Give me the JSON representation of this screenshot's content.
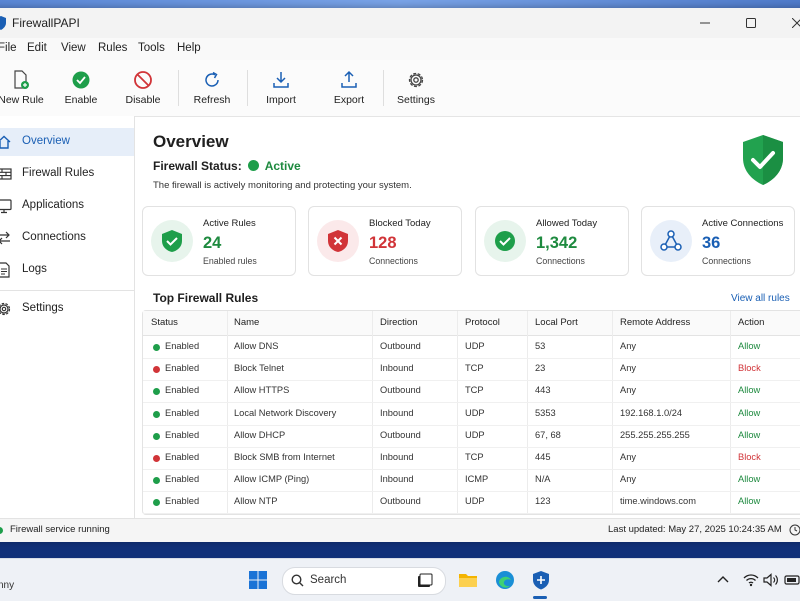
{
  "app": {
    "title": "FirewallPAPI"
  },
  "menu": [
    "File",
    "Edit",
    "View",
    "Rules",
    "Tools",
    "Help"
  ],
  "toolbar": [
    {
      "label": "New Rule",
      "icon": "new-rule-icon"
    },
    {
      "label": "Enable",
      "icon": "enable-icon"
    },
    {
      "label": "Disable",
      "icon": "disable-icon"
    },
    {
      "label": "Refresh",
      "icon": "refresh-icon"
    },
    {
      "label": "Import",
      "icon": "import-icon"
    },
    {
      "label": "Export",
      "icon": "export-icon"
    },
    {
      "label": "Settings",
      "icon": "gear-icon"
    }
  ],
  "sidebar": [
    {
      "label": "Overview",
      "icon": "home-icon",
      "active": true
    },
    {
      "label": "Firewall Rules",
      "icon": "firewall-icon"
    },
    {
      "label": "Applications",
      "icon": "monitor-icon"
    },
    {
      "label": "Connections",
      "icon": "arrows-icon"
    },
    {
      "label": "Logs",
      "icon": "document-icon"
    },
    {
      "label": "Settings",
      "icon": "gear-icon"
    }
  ],
  "overview": {
    "title": "Overview",
    "status_label": "Firewall Status:",
    "status_value": "Active",
    "description": "The firewall is actively monitoring and protecting your system."
  },
  "cards": [
    {
      "title": "Active Rules",
      "value": "24",
      "sub": "Enabled rules",
      "color": "#1e9e4a",
      "bg": "#e7f4ec",
      "icon": "shield-check-icon"
    },
    {
      "title": "Blocked Today",
      "value": "128",
      "sub": "Connections",
      "color": "#d13438",
      "bg": "#fbe9ea",
      "icon": "shield-x-icon"
    },
    {
      "title": "Allowed Today",
      "value": "1,342",
      "sub": "Connections",
      "color": "#1e9e4a",
      "bg": "#e7f4ec",
      "icon": "check-circle-icon"
    },
    {
      "title": "Active Connections",
      "value": "36",
      "sub": "Connections",
      "color": "#1a5fb4",
      "bg": "#e8eff9",
      "icon": "network-icon"
    }
  ],
  "rules_section": {
    "title": "Top Firewall Rules",
    "view_all": "View all rules"
  },
  "table": {
    "columns": [
      "Status",
      "Name",
      "Direction",
      "Protocol",
      "Local Port",
      "Remote Address",
      "Action"
    ],
    "rows": [
      {
        "status": "Enabled",
        "status_color": "#1e9e4a",
        "name": "Allow DNS",
        "direction": "Outbound",
        "protocol": "UDP",
        "port": "53",
        "remote": "Any",
        "action": "Allow",
        "action_color": "#1e8a3f"
      },
      {
        "status": "Enabled",
        "status_color": "#d13438",
        "name": "Block Telnet",
        "direction": "Inbound",
        "protocol": "TCP",
        "port": "23",
        "remote": "Any",
        "action": "Block",
        "action_color": "#d13438"
      },
      {
        "status": "Enabled",
        "status_color": "#1e9e4a",
        "name": "Allow HTTPS",
        "direction": "Outbound",
        "protocol": "TCP",
        "port": "443",
        "remote": "Any",
        "action": "Allow",
        "action_color": "#1e8a3f"
      },
      {
        "status": "Enabled",
        "status_color": "#1e9e4a",
        "name": "Local Network Discovery",
        "direction": "Inbound",
        "protocol": "UDP",
        "port": "5353",
        "remote": "192.168.1.0/24",
        "action": "Allow",
        "action_color": "#1e8a3f"
      },
      {
        "status": "Enabled",
        "status_color": "#1e9e4a",
        "name": "Allow DHCP",
        "direction": "Outbound",
        "protocol": "UDP",
        "port": "67, 68",
        "remote": "255.255.255.255",
        "action": "Allow",
        "action_color": "#1e8a3f"
      },
      {
        "status": "Enabled",
        "status_color": "#d13438",
        "name": "Block SMB from Internet",
        "direction": "Inbound",
        "protocol": "TCP",
        "port": "445",
        "remote": "Any",
        "action": "Block",
        "action_color": "#d13438"
      },
      {
        "status": "Enabled",
        "status_color": "#1e9e4a",
        "name": "Allow ICMP (Ping)",
        "direction": "Inbound",
        "protocol": "ICMP",
        "port": "N/A",
        "remote": "Any",
        "action": "Allow",
        "action_color": "#1e8a3f"
      },
      {
        "status": "Enabled",
        "status_color": "#1e9e4a",
        "name": "Allow NTP",
        "direction": "Outbound",
        "protocol": "UDP",
        "port": "123",
        "remote": "time.windows.com",
        "action": "Allow",
        "action_color": "#1e8a3f"
      }
    ]
  },
  "statusbar": {
    "left": "Firewall service running",
    "right": "Last updated: May 27, 2025 10:24:35 AM"
  },
  "taskbar": {
    "left_text": "nny",
    "search_placeholder": "Search"
  }
}
